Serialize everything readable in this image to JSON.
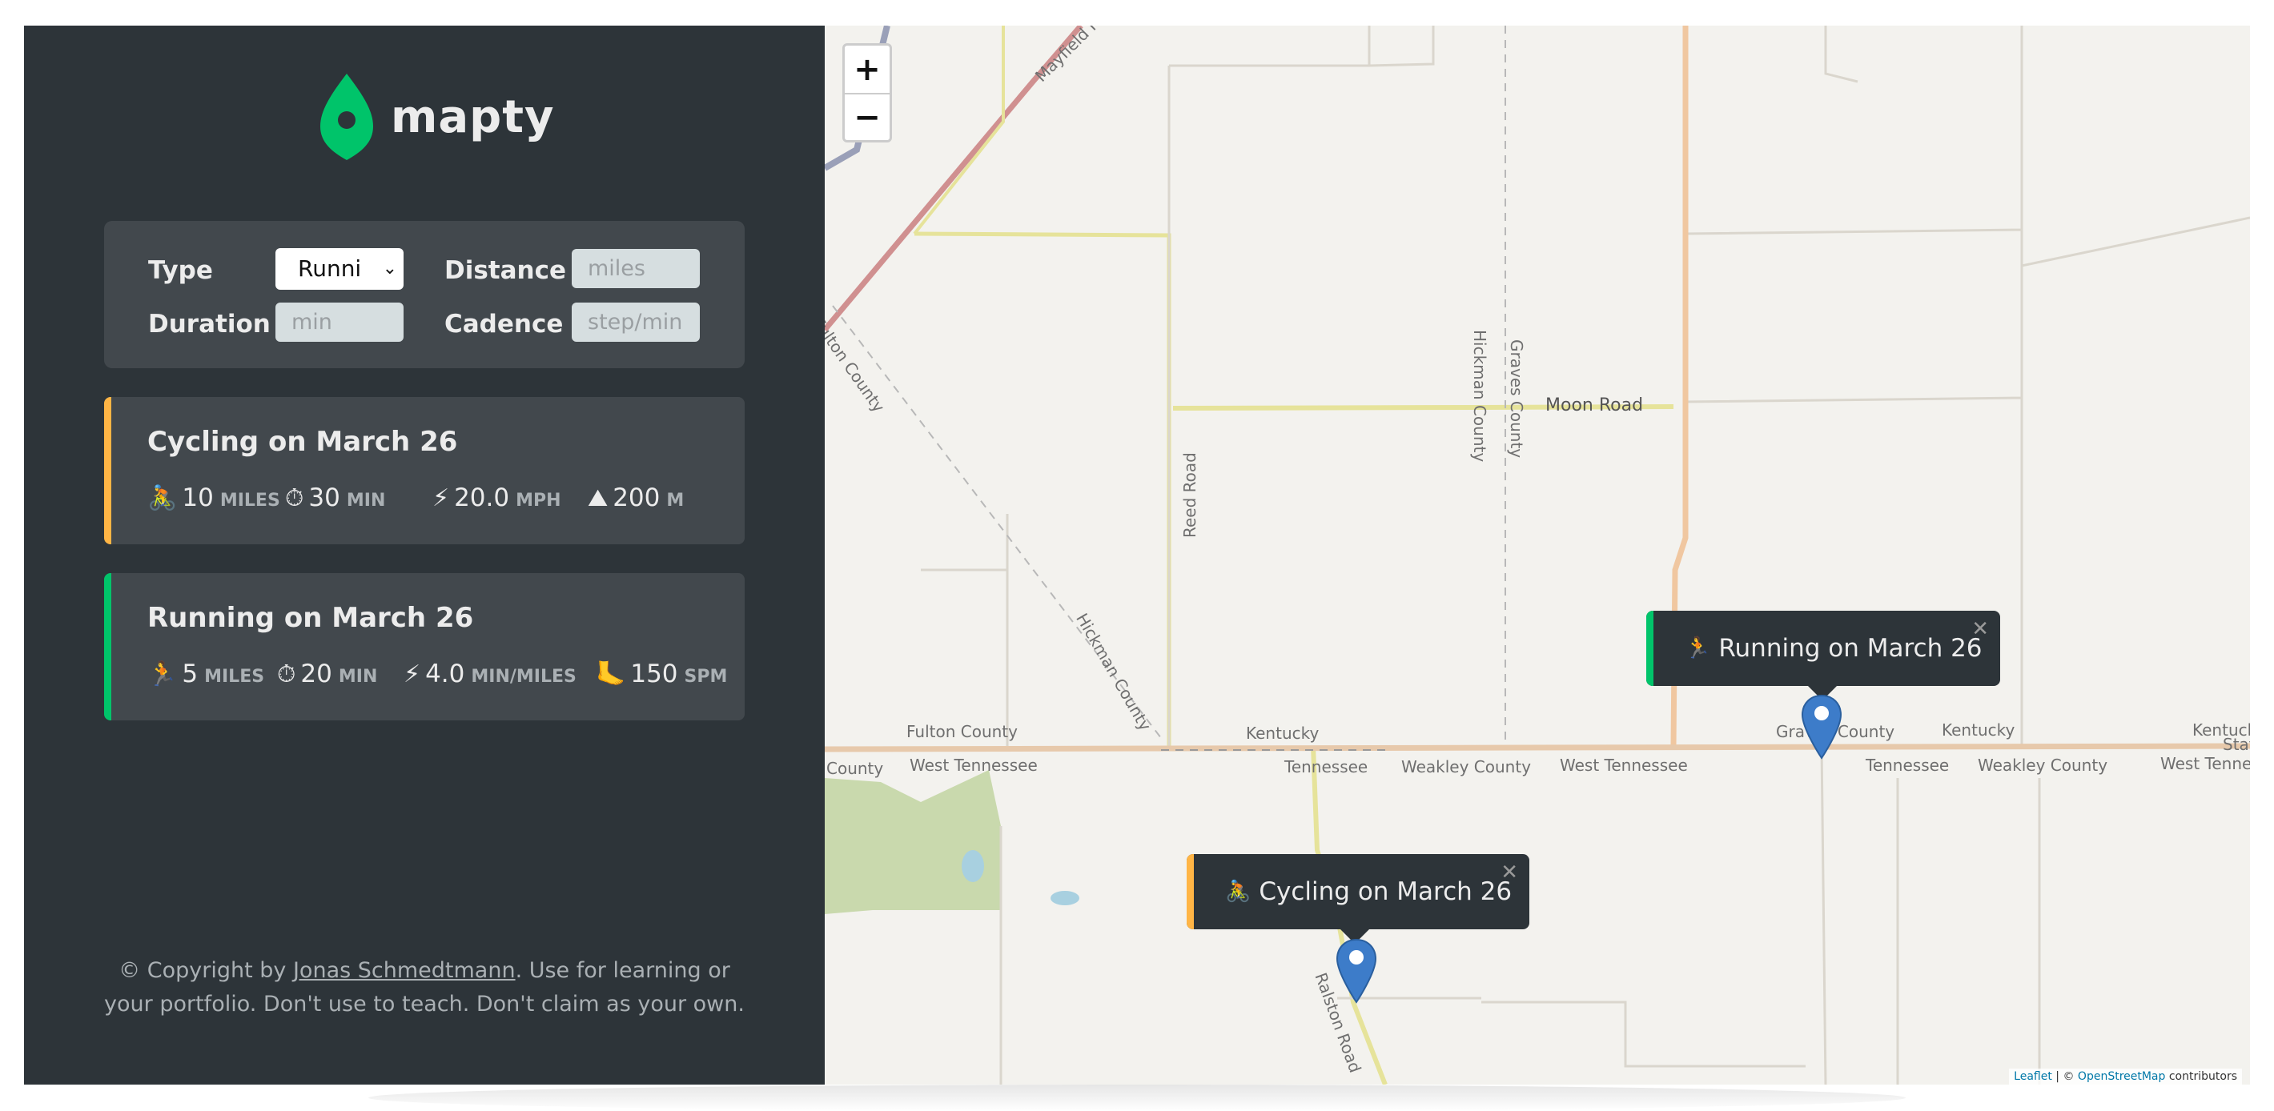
{
  "app": {
    "name": "mapty"
  },
  "form": {
    "type_label": "Type",
    "type_value": "Runni",
    "distance_label": "Distance",
    "distance_placeholder": "miles",
    "duration_label": "Duration",
    "duration_placeholder": "min",
    "cadence_label": "Cadence",
    "cadence_placeholder": "step/min"
  },
  "workouts": [
    {
      "title": "Cycling on March 26",
      "kind": "cycling",
      "color": "#ffb545",
      "stats": [
        {
          "icon": "🚴",
          "value": "10",
          "unit": "miles"
        },
        {
          "icon": "⏱",
          "value": "30",
          "unit": "min"
        },
        {
          "icon": "⚡",
          "value": "20.0",
          "unit": "mph"
        },
        {
          "icon": "⛰",
          "value": "200",
          "unit": "m"
        }
      ]
    },
    {
      "title": "Running on March 26",
      "kind": "running",
      "color": "#00c46a",
      "stats": [
        {
          "icon": "🏃",
          "value": "5",
          "unit": "miles"
        },
        {
          "icon": "⏱",
          "value": "20",
          "unit": "min"
        },
        {
          "icon": "⚡",
          "value": "4.0",
          "unit": "min/miles"
        },
        {
          "icon": "🦶",
          "value": "150",
          "unit": "spm"
        }
      ]
    }
  ],
  "footer": {
    "prefix": "© Copyright by ",
    "author": "Jonas Schmedtmann",
    "suffix": ". Use for learning or your portfolio. Don't use to teach. Don't claim as your own."
  },
  "map": {
    "zoom_in": "+",
    "zoom_out": "−",
    "popups": [
      {
        "icon": "🏃",
        "text": "Running on March 26",
        "close": "✕"
      },
      {
        "icon": "🚴",
        "text": "Cycling on March 26",
        "close": "✕"
      }
    ],
    "labels": {
      "mayfield_road": "Mayfield Road",
      "fulton_county_diag": "Fulton County",
      "hickman_county_v": "Hickman County",
      "graves_county_v": "Graves County",
      "moon_road": "Moon Road",
      "reed_road": "Reed Road",
      "hickman_county_diag": "Hickman County",
      "fulton_county": "Fulton County",
      "kentucky_1": "Kentucky",
      "graves_county": "Graves County",
      "kentucky_2": "Kentucky",
      "kentucky_3": "Kentucky",
      "state": "State",
      "county": "County",
      "west_tennessee_1": "West Tennessee",
      "tennessee_1": "Tennessee",
      "weakley_county_1": "Weakley County",
      "west_tennessee_2": "West Tennessee",
      "tennessee_2": "Tennessee",
      "weakley_county_2": "Weakley County",
      "west_tennessee_3": "West Tenness",
      "ralston_road": "Ralston Road"
    },
    "attribution": {
      "leaflet": "Leaflet",
      "sep": " | © ",
      "osm": "OpenStreetMap",
      "tail": " contributors"
    }
  }
}
